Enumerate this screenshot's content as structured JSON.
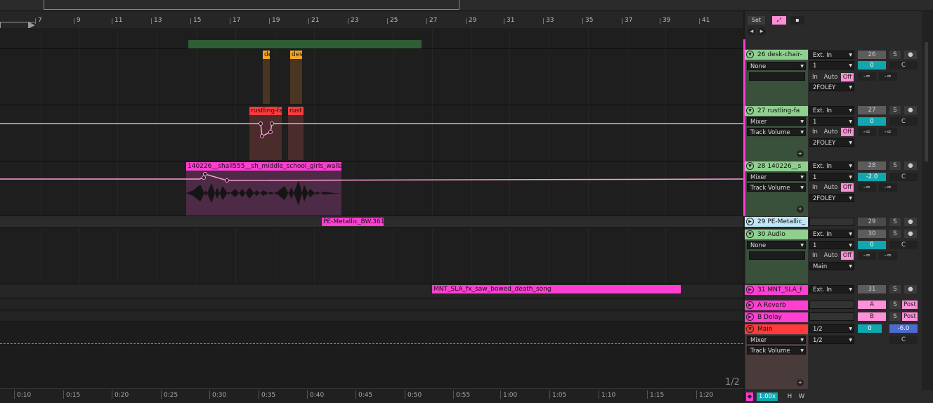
{
  "ruler": {
    "bars": [
      "7",
      "9",
      "11",
      "13",
      "15",
      "17",
      "19",
      "21",
      "23",
      "25",
      "27",
      "29",
      "31",
      "33",
      "35",
      "37",
      "39",
      "41"
    ]
  },
  "timeline": {
    "labels": [
      "0:10",
      "0:15",
      "0:20",
      "0:25",
      "0:30",
      "0:35",
      "0:40",
      "0:45",
      "0:50",
      "0:55",
      "1:00",
      "1:05",
      "1:10",
      "1:15",
      "1:20"
    ],
    "page": "1/2",
    "zoom": "1.00x",
    "h_label": "H",
    "w_label": "W"
  },
  "controls": {
    "set_label": "Set",
    "nav_left": "◂",
    "nav_right": "▸"
  },
  "clips": {
    "desk1": "de",
    "desk2": "des",
    "rustle1": "rustling-fa",
    "rustle2": "rust",
    "girls": "140226__shall555__sh_middle_school_girls_walla",
    "metallic": "PE-Metallic_BW.361",
    "saw": "MNT_SLA_fx_saw_bowed_death_song"
  },
  "tracks": [
    {
      "name": "26 desk-chair-",
      "input": "Ext. In",
      "channel": "1",
      "routing1": "None",
      "monitor": [
        "In",
        "Auto",
        "Off"
      ],
      "output": "2FOLEY",
      "number": "26",
      "vol": "0",
      "pan": "C",
      "peak1": "-∞",
      "peak2": "-∞"
    },
    {
      "name": "27 rustling-fa",
      "input": "Ext. In",
      "channel": "1",
      "routing1": "Mixer",
      "routing2": "Track Volume",
      "monitor": [
        "In",
        "Auto",
        "Off"
      ],
      "output": "2FOLEY",
      "number": "27",
      "vol": "0",
      "pan": "C",
      "peak1": "-∞",
      "peak2": "-∞"
    },
    {
      "name": "28 140226__s",
      "input": "Ext. In",
      "channel": "1",
      "routing1": "Mixer",
      "routing2": "Track Volume",
      "monitor": [
        "In",
        "Auto",
        "Off"
      ],
      "output": "2FOLEY",
      "number": "28",
      "vol": "-2.0",
      "pan": "C",
      "peak1": "-∞",
      "peak2": "-∞"
    },
    {
      "name": "29 PE-Metallic_",
      "number": "29"
    },
    {
      "name": "30 Audio",
      "input": "Ext. In",
      "channel": "1",
      "routing1": "None",
      "monitor": [
        "In",
        "Auto",
        "Off"
      ],
      "output": "Main",
      "number": "30",
      "vol": "0",
      "pan": "C",
      "peak1": "-∞",
      "peak2": "-∞"
    },
    {
      "name": "31 MNT_SLA_f",
      "input": "Ext. In",
      "number": "31"
    },
    {
      "name": "A Reverb",
      "send": "A",
      "post": "Post"
    },
    {
      "name": "B Delay",
      "send": "B",
      "post": "Post"
    },
    {
      "name": "Main",
      "routing1": "Mixer",
      "routing2": "Track Volume",
      "out1": "1/2",
      "out2": "1/2",
      "vol": "0",
      "vol2": "-6.0",
      "pan": "C"
    }
  ],
  "common": {
    "solo": "S",
    "plus": "+"
  },
  "colors": {
    "accent": "#ff39d4",
    "green_track": "#8fcf8f",
    "orange_clip": "#f5a623",
    "red_clip": "#ff3b3b",
    "pink_clip": "#ff3fd2",
    "teal": "#11a7b0"
  }
}
